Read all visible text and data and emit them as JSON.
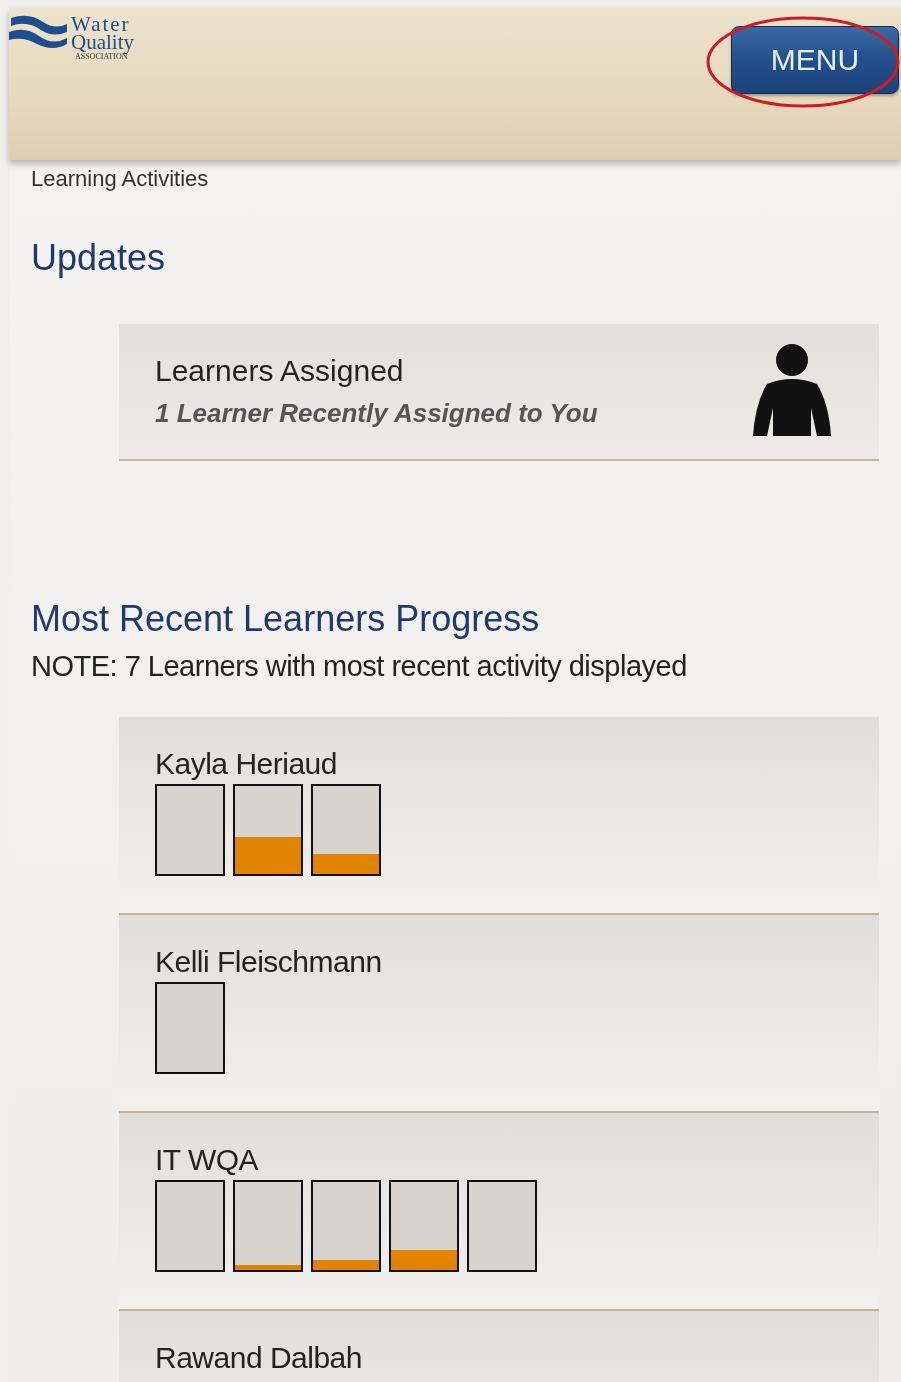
{
  "header": {
    "logo": {
      "line_1": "Water",
      "line_2": "Quality",
      "line_3": "ASSOCIATION"
    },
    "menu_button": {
      "label": "MENU",
      "circled": true
    }
  },
  "section_title": "Learning Activities",
  "updates": {
    "title": "Updates",
    "cards": [
      {
        "title": "Learners Assigned",
        "subtitle": "1 Learner Recently Assigned to You"
      }
    ]
  },
  "progress": {
    "title": "Most Recent Learners Progress",
    "note": "NOTE: 7 Learners with most recent activity displayed",
    "learners": [
      {
        "name": "Kayla Heriaud",
        "meters": [
          {
            "level": 0
          },
          {
            "level": 0.42
          },
          {
            "level": 0.23
          }
        ]
      },
      {
        "name": "Kelli Fleischmann",
        "meters": [
          {
            "level": 0
          }
        ]
      },
      {
        "name": "IT WQA",
        "meters": [
          {
            "level": 0
          },
          {
            "level": 0.05
          },
          {
            "level": 0.11
          },
          {
            "level": 0.22
          },
          {
            "level": 0
          }
        ]
      },
      {
        "name": "Rawand Dalbah"
      }
    ]
  }
}
